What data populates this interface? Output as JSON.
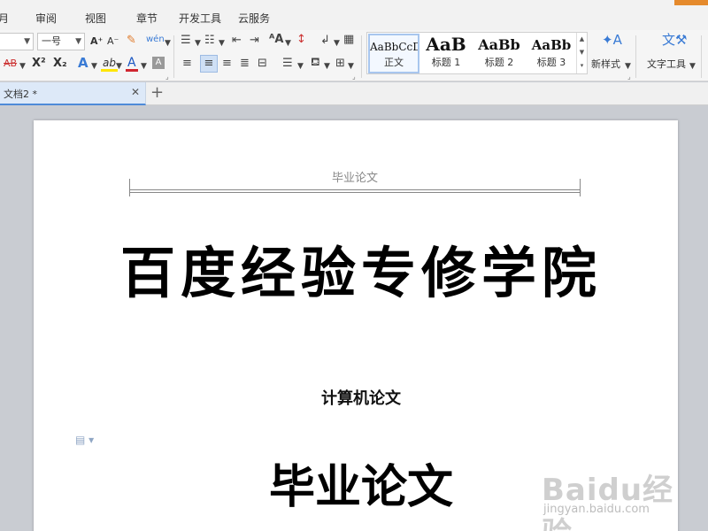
{
  "menu": {
    "tabs": [
      "月",
      "审阅",
      "视图",
      "章节",
      "开发工具",
      "云服务"
    ]
  },
  "ribbon": {
    "font_name": "",
    "font_size": "一号",
    "buttons": {
      "grow_font": "A⁺",
      "shrink_font": "A⁻",
      "strikethrough": "AB",
      "superscript": "X²",
      "subscript": "X₂",
      "text_effect": "A",
      "highlight": "ab",
      "font_color": "A",
      "char_shading": "A"
    },
    "styles": [
      {
        "preview": "AaBbCcD",
        "label": "正文"
      },
      {
        "preview": "AaB",
        "label": "标题 1"
      },
      {
        "preview": "AaBb",
        "label": "标题 2"
      },
      {
        "preview": "AaBb",
        "label": "标题 3"
      }
    ],
    "new_style": "新样式",
    "text_tools": "文字工具"
  },
  "document_tab": {
    "name": "文档2 *"
  },
  "document": {
    "header": "毕业论文",
    "title": "百度经验专修学院",
    "subtitle": "计算机论文",
    "big_heading": "毕业论文"
  },
  "watermark": {
    "main": "Baidu经验",
    "sub": "jingyan.baidu.com"
  },
  "colors": {
    "accent": "#4e8ad8",
    "active_align": "#cfe0f5",
    "highlight_bar": "#ffe600",
    "font_color_bar": "#d0262f",
    "corner": "#e58a2c"
  }
}
